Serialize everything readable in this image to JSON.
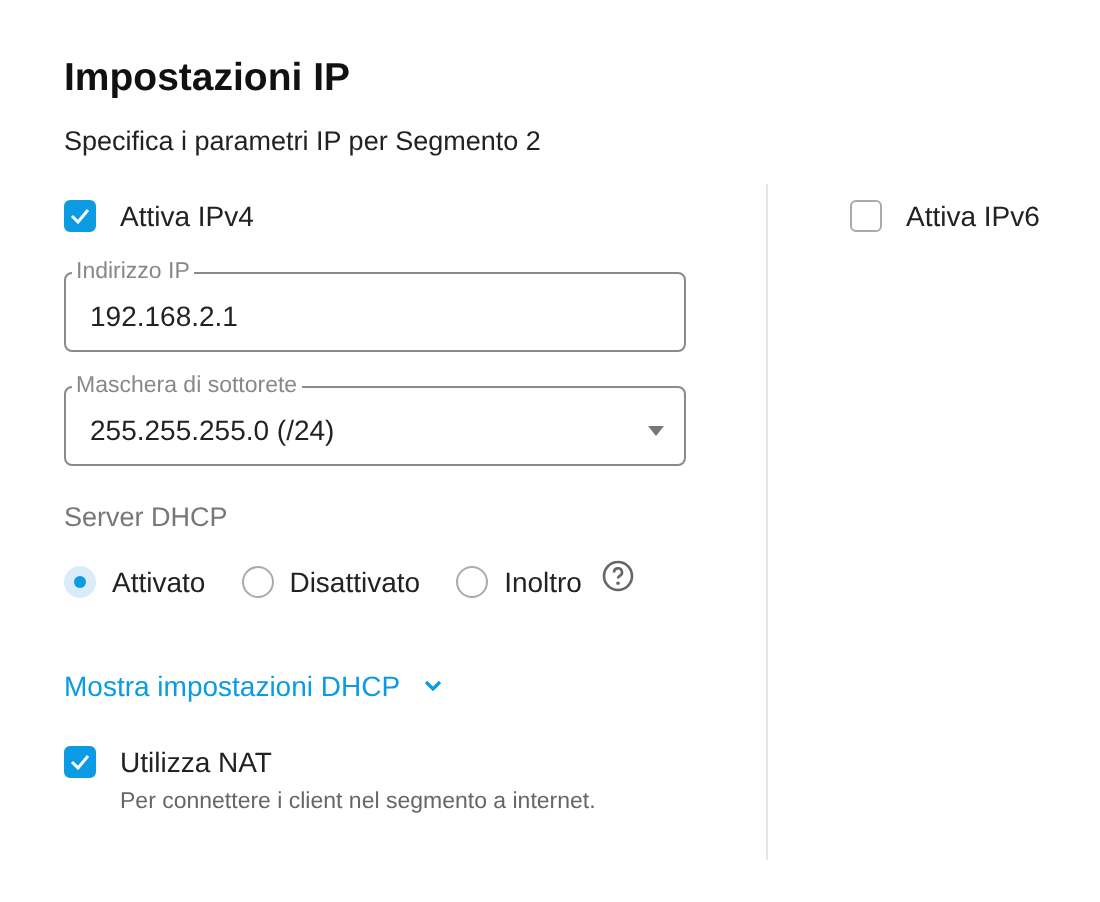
{
  "title": "Impostazioni IP",
  "subtitle": "Specifica i parametri IP per Segmento 2",
  "ipv4": {
    "label": "Attiva IPv4",
    "checked": true
  },
  "fields": [
    {
      "kind": "text",
      "label": "Indirizzo IP",
      "value": "192.168.2.1"
    },
    {
      "kind": "select",
      "label": "Maschera di sottorete",
      "value": "255.255.255.0 (/24)"
    }
  ],
  "dhcp": {
    "label": "Server DHCP",
    "options": [
      {
        "label": "Attivato",
        "selected": true
      },
      {
        "label": "Disattivato",
        "selected": false
      },
      {
        "label": "Inoltro",
        "selected": false
      }
    ]
  },
  "dhcp_link": "Mostra impostazioni DHCP",
  "nat": {
    "label": "Utilizza NAT",
    "checked": true,
    "hint": "Per connettere i client nel segmento a internet."
  },
  "ipv6": {
    "label": "Attiva IPv6",
    "checked": false
  }
}
